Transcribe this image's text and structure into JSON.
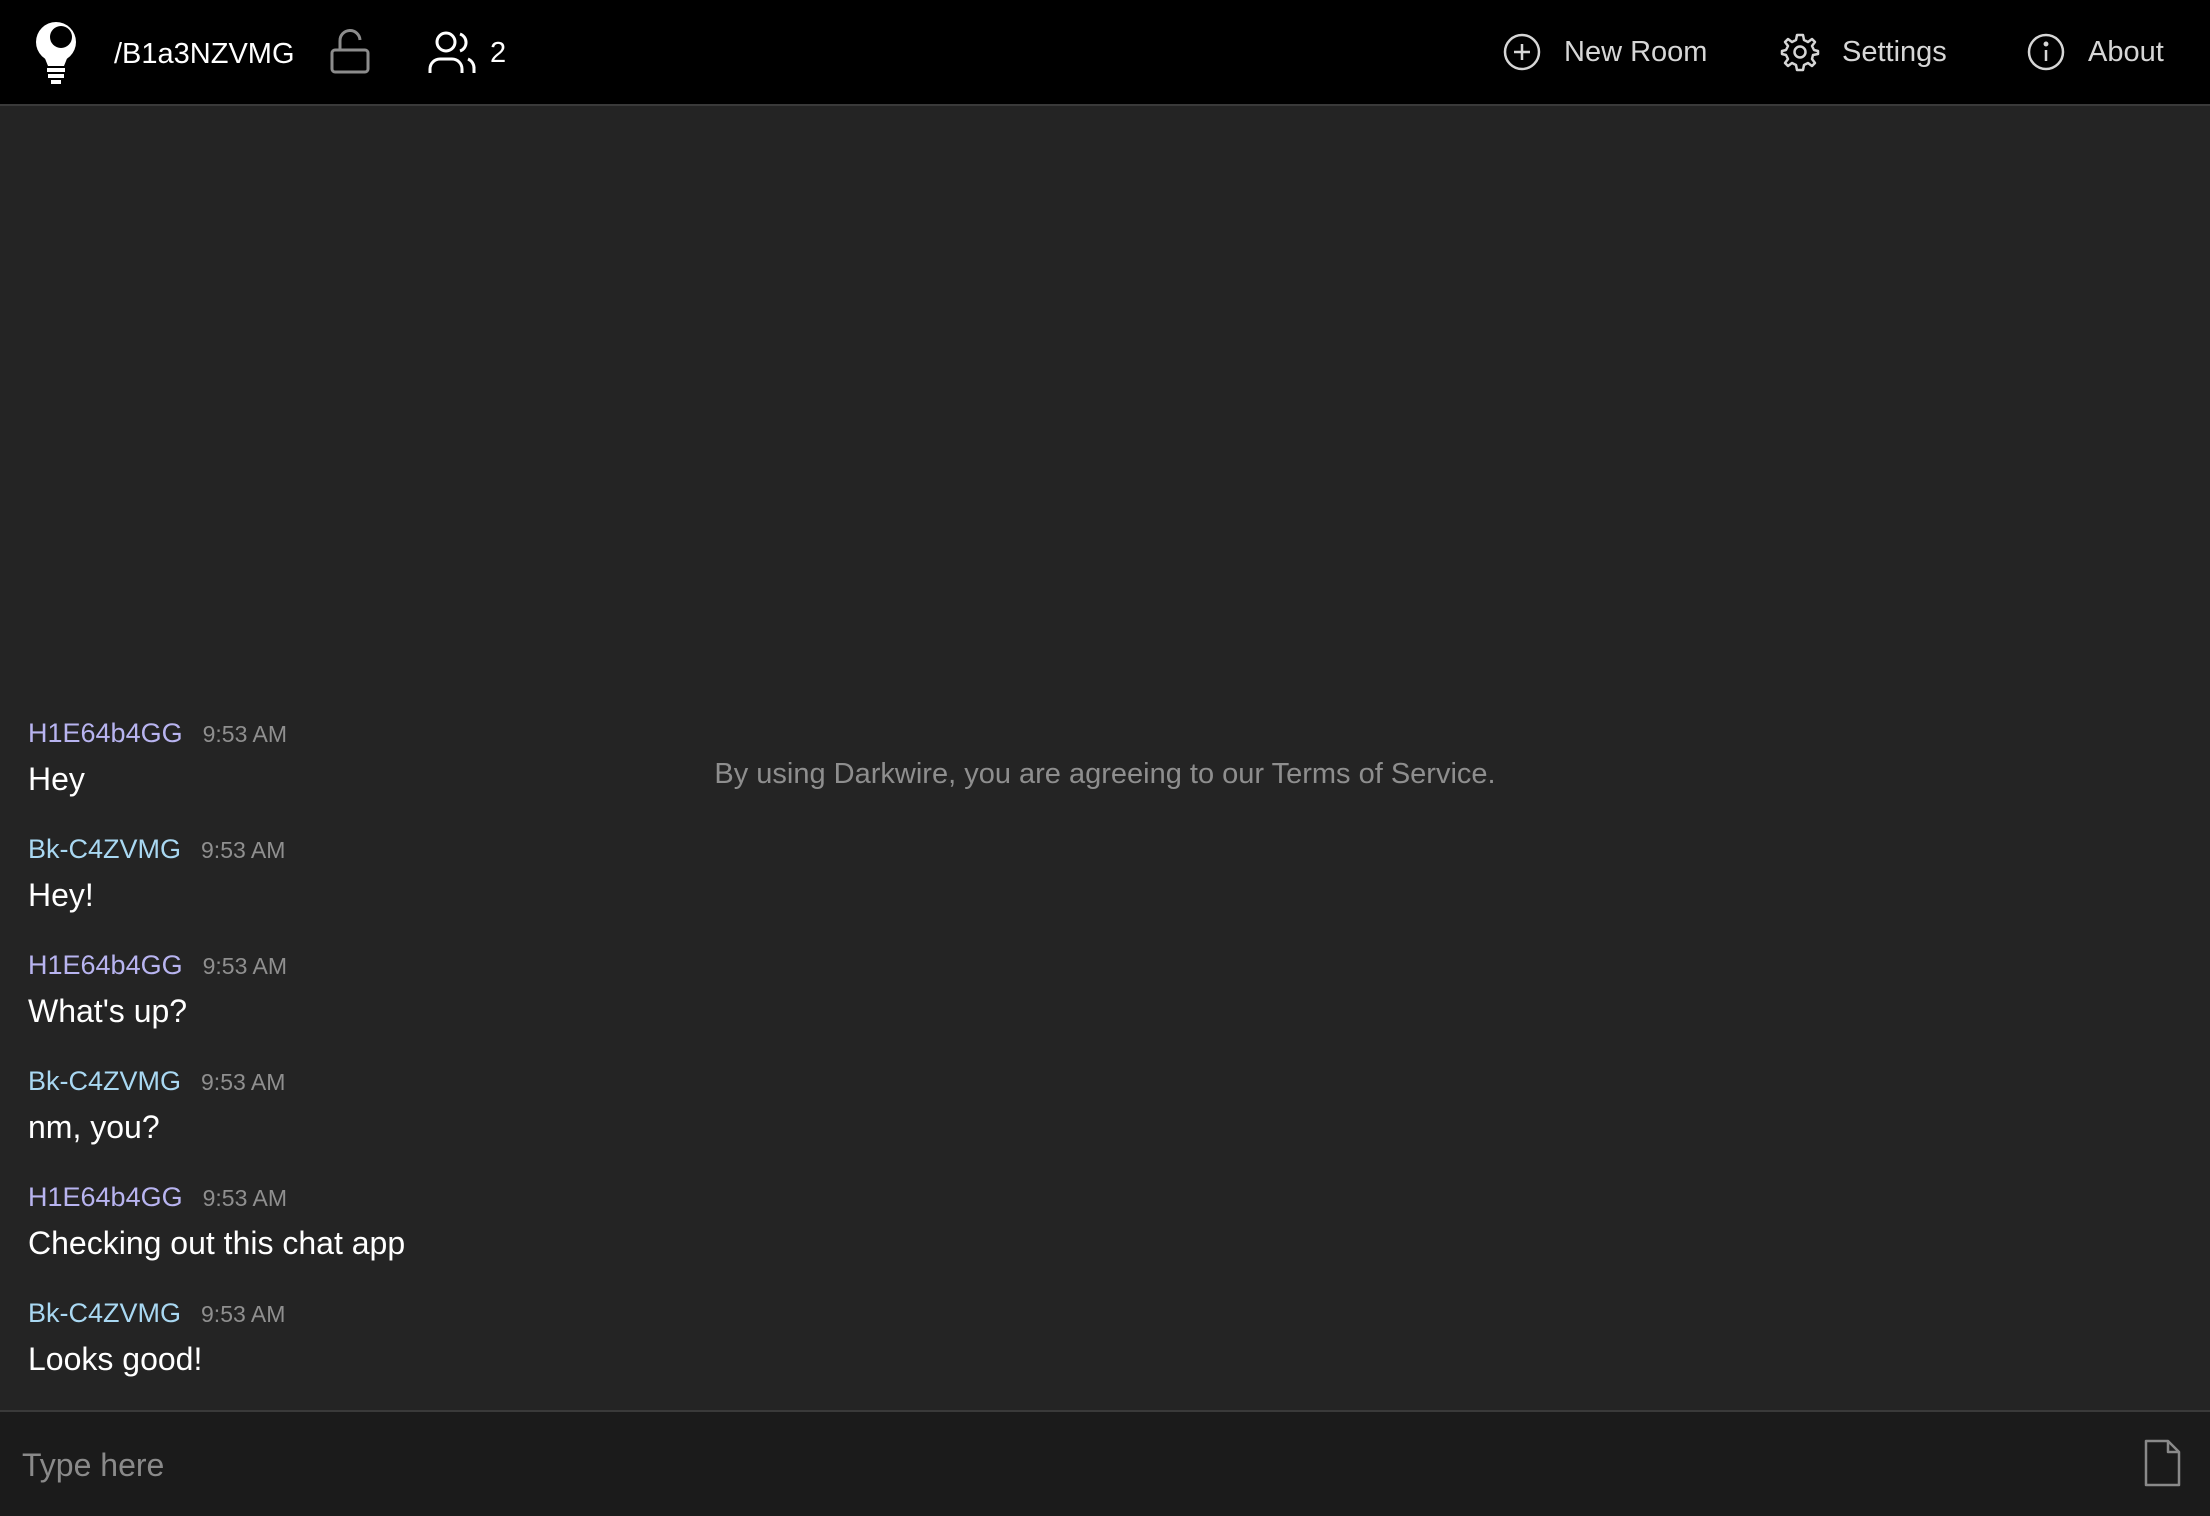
{
  "header": {
    "room_name": "/B1a3NZVMG",
    "user_count": "2",
    "nav": {
      "new_room": "New Room",
      "settings": "Settings",
      "about": "About"
    }
  },
  "chat": {
    "tos_notice": "By using Darkwire, you are agreeing to our Terms of Service.",
    "messages": [
      {
        "user": "H1E64b4GG",
        "time": "9:53 AM",
        "text": "Hey"
      },
      {
        "user": "Bk-C4ZVMG",
        "time": "9:53 AM",
        "text": "Hey!"
      },
      {
        "user": "H1E64b4GG",
        "time": "9:53 AM",
        "text": "What's up?"
      },
      {
        "user": "Bk-C4ZVMG",
        "time": "9:53 AM",
        "text": "nm, you?"
      },
      {
        "user": "H1E64b4GG",
        "time": "9:53 AM",
        "text": "Checking out this chat app"
      },
      {
        "user": "Bk-C4ZVMG",
        "time": "9:53 AM",
        "text": "Looks good!"
      }
    ]
  },
  "compose": {
    "placeholder": "Type here"
  },
  "colors": {
    "user_a": "#b8b4f0",
    "user_b": "#a9d8f2",
    "background": "#242424",
    "navbar": "#000000"
  },
  "icons": [
    "logo-icon",
    "unlock-icon",
    "users-icon",
    "plus-circle-icon",
    "gear-icon",
    "info-icon",
    "file-icon"
  ]
}
